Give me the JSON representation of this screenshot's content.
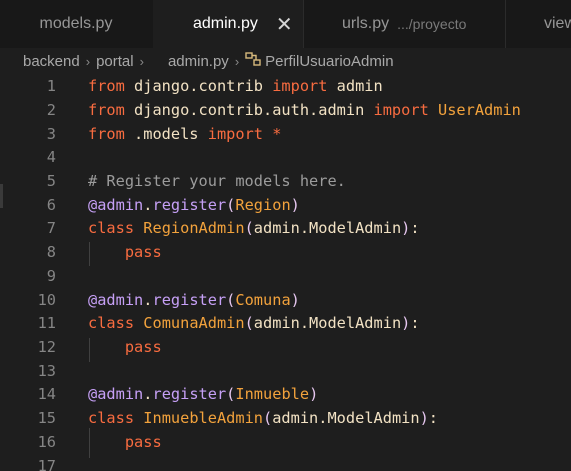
{
  "tabs": [
    {
      "label": "models.py",
      "hint": ""
    },
    {
      "label": "admin.py",
      "hint": "",
      "active": true,
      "close": "✕"
    },
    {
      "label": "urls.py",
      "hint": ".../proyecto"
    },
    {
      "label": "view",
      "hint": ""
    }
  ],
  "breadcrumb": {
    "items": [
      "backend",
      "portal",
      "admin.py",
      "PerfilUsuarioAdmin"
    ],
    "separator": "›",
    "symbol_icon": "class-symbol-icon"
  },
  "editor": {
    "lines": [
      {
        "n": "1",
        "tokens": [
          [
            "kw",
            "from"
          ],
          [
            "id",
            " django.contrib "
          ],
          [
            "kw",
            "import"
          ],
          [
            "id",
            " admin"
          ]
        ]
      },
      {
        "n": "2",
        "tokens": [
          [
            "kw",
            "from"
          ],
          [
            "id",
            " django.contrib.auth.admin "
          ],
          [
            "kw",
            "import"
          ],
          [
            "cls",
            " UserAdmin"
          ]
        ]
      },
      {
        "n": "3",
        "tokens": [
          [
            "kw",
            "from"
          ],
          [
            "id",
            " .models "
          ],
          [
            "kw",
            "import"
          ],
          [
            "op",
            " *"
          ]
        ]
      },
      {
        "n": "4",
        "tokens": []
      },
      {
        "n": "5",
        "tokens": [
          [
            "cm",
            "# Register your models here."
          ]
        ]
      },
      {
        "n": "6",
        "tokens": [
          [
            "dec",
            "@admin"
          ],
          [
            "id",
            "."
          ],
          [
            "dec",
            "register"
          ],
          [
            "paren",
            "("
          ],
          [
            "cls",
            "Region"
          ],
          [
            "paren",
            ")"
          ]
        ]
      },
      {
        "n": "7",
        "tokens": [
          [
            "kw",
            "class"
          ],
          [
            "cls",
            " RegionAdmin"
          ],
          [
            "paren",
            "("
          ],
          [
            "id",
            "admin.ModelAdmin"
          ],
          [
            "paren",
            ")"
          ],
          [
            "id",
            ":"
          ]
        ]
      },
      {
        "n": "8",
        "tokens": [
          [
            "id",
            "    "
          ],
          [
            "kw",
            "pass"
          ]
        ]
      },
      {
        "n": "9",
        "tokens": []
      },
      {
        "n": "10",
        "tokens": [
          [
            "dec",
            "@admin"
          ],
          [
            "id",
            "."
          ],
          [
            "dec",
            "register"
          ],
          [
            "paren",
            "("
          ],
          [
            "cls",
            "Comuna"
          ],
          [
            "paren",
            ")"
          ]
        ]
      },
      {
        "n": "11",
        "tokens": [
          [
            "kw",
            "class"
          ],
          [
            "cls",
            " ComunaAdmin"
          ],
          [
            "paren",
            "("
          ],
          [
            "id",
            "admin.ModelAdmin"
          ],
          [
            "paren",
            ")"
          ],
          [
            "id",
            ":"
          ]
        ]
      },
      {
        "n": "12",
        "tokens": [
          [
            "id",
            "    "
          ],
          [
            "kw",
            "pass"
          ]
        ]
      },
      {
        "n": "13",
        "tokens": []
      },
      {
        "n": "14",
        "tokens": [
          [
            "dec",
            "@admin"
          ],
          [
            "id",
            "."
          ],
          [
            "dec",
            "register"
          ],
          [
            "paren",
            "("
          ],
          [
            "cls",
            "Inmueble"
          ],
          [
            "paren",
            ")"
          ]
        ]
      },
      {
        "n": "15",
        "tokens": [
          [
            "kw",
            "class"
          ],
          [
            "cls",
            " InmuebleAdmin"
          ],
          [
            "paren",
            "("
          ],
          [
            "id",
            "admin.ModelAdmin"
          ],
          [
            "paren",
            ")"
          ],
          [
            "id",
            ":"
          ]
        ]
      },
      {
        "n": "16",
        "tokens": [
          [
            "id",
            "    "
          ],
          [
            "kw",
            "pass"
          ]
        ]
      },
      {
        "n": "17",
        "tokens": []
      }
    ]
  }
}
